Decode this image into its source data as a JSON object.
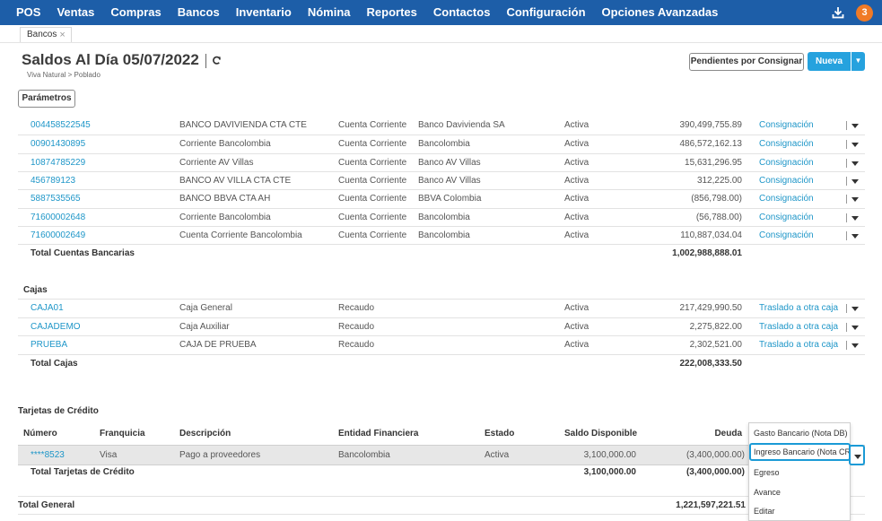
{
  "nav": {
    "items": [
      "POS",
      "Ventas",
      "Compras",
      "Bancos",
      "Inventario",
      "Nómina",
      "Reportes",
      "Contactos",
      "Configuración",
      "Opciones Avanzadas"
    ],
    "badge": "3"
  },
  "tab": {
    "label": "Bancos",
    "close": "×"
  },
  "header": {
    "title": "Saldos Al Día 05/07/2022",
    "breadcrumb": "Viva Natural > Poblado",
    "pendientes": "Pendientes por Consignar",
    "nueva": "Nueva",
    "parametros": "Parámetros"
  },
  "accounts": [
    {
      "num": "004458522545",
      "desc": "BANCO DAVIVIENDA CTA CTE",
      "tipo": "Cuenta Corriente",
      "banco": "Banco Davivienda SA",
      "estado": "Activa",
      "saldo": "390,499,755.89",
      "accion": "Consignación"
    },
    {
      "num": "00901430895",
      "desc": "Corriente Bancolombia",
      "tipo": "Cuenta Corriente",
      "banco": "Bancolombia",
      "estado": "Activa",
      "saldo": "486,572,162.13",
      "accion": "Consignación"
    },
    {
      "num": "10874785229",
      "desc": "Corriente AV Villas",
      "tipo": "Cuenta Corriente",
      "banco": "Banco AV Villas",
      "estado": "Activa",
      "saldo": "15,631,296.95",
      "accion": "Consignación"
    },
    {
      "num": "456789123",
      "desc": "BANCO AV VILLA CTA CTE",
      "tipo": "Cuenta Corriente",
      "banco": "Banco AV Villas",
      "estado": "Activa",
      "saldo": "312,225.00",
      "accion": "Consignación"
    },
    {
      "num": "5887535565",
      "desc": "BANCO BBVA CTA AH",
      "tipo": "Cuenta Corriente",
      "banco": "BBVA Colombia",
      "estado": "Activa",
      "saldo": "(856,798.00)",
      "accion": "Consignación"
    },
    {
      "num": "71600002648",
      "desc": "Corriente Bancolombia",
      "tipo": "Cuenta Corriente",
      "banco": "Bancolombia",
      "estado": "Activa",
      "saldo": "(56,788.00)",
      "accion": "Consignación"
    },
    {
      "num": "71600002649",
      "desc": "Cuenta Corriente Bancolombia",
      "tipo": "Cuenta Corriente",
      "banco": "Bancolombia",
      "estado": "Activa",
      "saldo": "110,887,034.04",
      "accion": "Consignación"
    }
  ],
  "total_cuentas": {
    "label": "Total Cuentas Bancarias",
    "value": "1,002,988,888.01"
  },
  "cajas_title": "Cajas",
  "cajas": [
    {
      "num": "CAJA01",
      "desc": "Caja General",
      "tipo": "Recaudo",
      "estado": "Activa",
      "saldo": "217,429,990.50",
      "accion": "Traslado a otra caja"
    },
    {
      "num": "CAJADEMO",
      "desc": "Caja Auxiliar",
      "tipo": "Recaudo",
      "estado": "Activa",
      "saldo": "2,275,822.00",
      "accion": "Traslado a otra caja"
    },
    {
      "num": "PRUEBA",
      "desc": "CAJA DE PRUEBA",
      "tipo": "Recaudo",
      "estado": "Activa",
      "saldo": "2,302,521.00",
      "accion": "Traslado a otra caja"
    }
  ],
  "total_cajas": {
    "label": "Total Cajas",
    "value": "222,008,333.50"
  },
  "tarjetas_title": "Tarjetas de Crédito",
  "tarjetas_headers": [
    "Número",
    "Franquicia",
    "Descripción",
    "Entidad Financiera",
    "Estado",
    "Saldo Disponible",
    "Deuda"
  ],
  "tarjetas": [
    {
      "num": "****8523",
      "franquicia": "Visa",
      "desc": "Pago a proveedores",
      "entidad": "Bancolombia",
      "estado": "Activa",
      "disponible": "3,100,000.00",
      "deuda": "(3,400,000.00)"
    }
  ],
  "total_tarjetas": {
    "label": "Total Tarjetas de Crédito",
    "disponible": "3,100,000.00",
    "deuda": "(3,400,000.00)"
  },
  "total_general": {
    "label": "Total General",
    "value": "1,221,597,221.51"
  },
  "menu": [
    "Gasto Bancario (Nota DB)",
    "Ingreso Bancario (Nota CR)",
    "Egreso",
    "Avance",
    "Editar"
  ],
  "colors": {
    "nav": "#1d5ea8",
    "link": "#1e96c8",
    "primary": "#26a2de",
    "badge": "#f07a26"
  }
}
